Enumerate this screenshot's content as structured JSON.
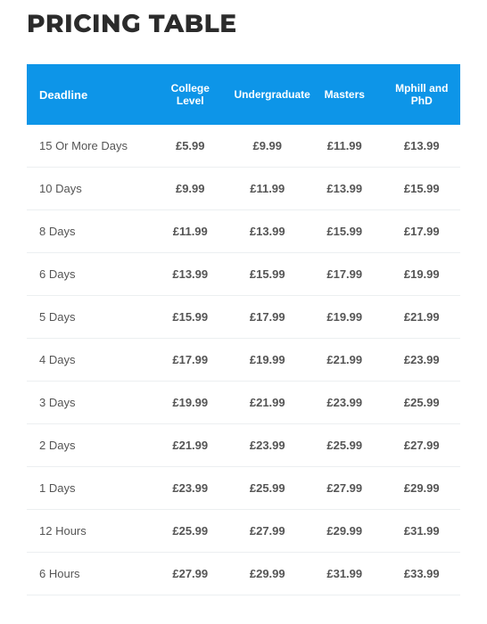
{
  "title": "PRICING TABLE",
  "columns": [
    "Deadline",
    "College Level",
    "Undergraduate",
    "Masters",
    "Mphill and PhD"
  ],
  "rows": [
    {
      "deadline": "15 Or More Days",
      "college": "£5.99",
      "undergrad": "£9.99",
      "masters": "£11.99",
      "phd": "£13.99"
    },
    {
      "deadline": "10 Days",
      "college": "£9.99",
      "undergrad": "£11.99",
      "masters": "£13.99",
      "phd": "£15.99"
    },
    {
      "deadline": "8 Days",
      "college": "£11.99",
      "undergrad": "£13.99",
      "masters": "£15.99",
      "phd": "£17.99"
    },
    {
      "deadline": "6 Days",
      "college": "£13.99",
      "undergrad": "£15.99",
      "masters": "£17.99",
      "phd": "£19.99"
    },
    {
      "deadline": "5 Days",
      "college": "£15.99",
      "undergrad": "£17.99",
      "masters": "£19.99",
      "phd": "£21.99"
    },
    {
      "deadline": "4 Days",
      "college": "£17.99",
      "undergrad": "£19.99",
      "masters": "£21.99",
      "phd": "£23.99"
    },
    {
      "deadline": "3 Days",
      "college": "£19.99",
      "undergrad": "£21.99",
      "masters": "£23.99",
      "phd": "£25.99"
    },
    {
      "deadline": "2 Days",
      "college": "£21.99",
      "undergrad": "£23.99",
      "masters": "£25.99",
      "phd": "£27.99"
    },
    {
      "deadline": "1 Days",
      "college": "£23.99",
      "undergrad": "£25.99",
      "masters": "£27.99",
      "phd": "£29.99"
    },
    {
      "deadline": "12 Hours",
      "college": "£25.99",
      "undergrad": "£27.99",
      "masters": "£29.99",
      "phd": "£31.99"
    },
    {
      "deadline": "6 Hours",
      "college": "£27.99",
      "undergrad": "£29.99",
      "masters": "£31.99",
      "phd": "£33.99"
    }
  ]
}
